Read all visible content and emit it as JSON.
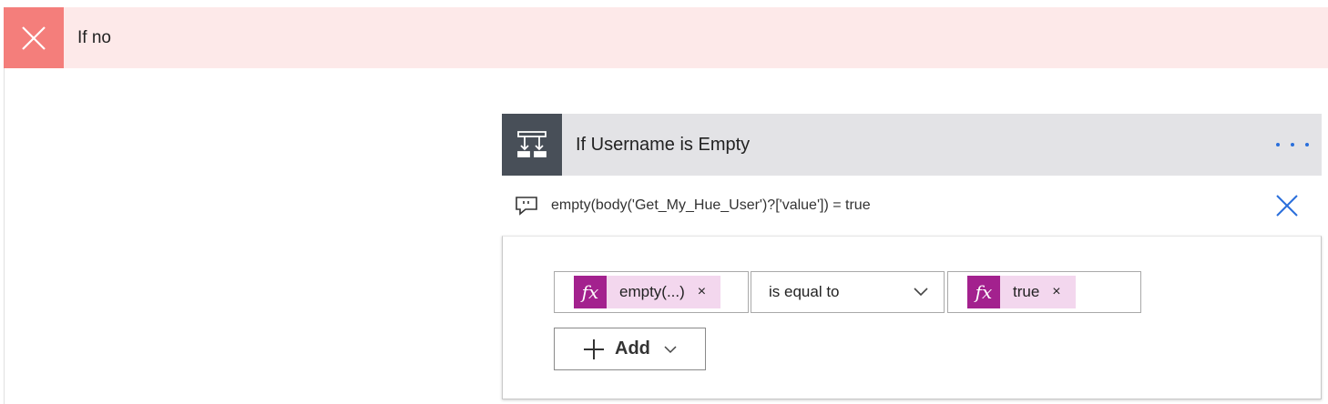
{
  "branch": {
    "title": "If no",
    "icon": "close-icon",
    "accent_color": "#f47e7b",
    "background_color": "#fde9e9"
  },
  "condition_card": {
    "title": "If Username is Empty",
    "icon": "condition-icon",
    "more_icon": "more-options-icon",
    "expression": {
      "icon": "comment-icon",
      "text": "empty(body('Get_My_Hue_User')?['value']) = true",
      "close_icon": "close-icon"
    },
    "row": {
      "left_token": {
        "label": "empty(...)",
        "fx_icon": "fx-icon",
        "remove": "×"
      },
      "operator": {
        "selected": "is equal to",
        "icon": "chevron-down-icon"
      },
      "right_token": {
        "label": "true",
        "fx_icon": "fx-icon",
        "remove": "×"
      }
    },
    "add_button": {
      "label": "Add",
      "icon": "plus-icon"
    }
  },
  "colors": {
    "token_fx": "#a3218e",
    "token_bg": "#f3d7ee",
    "link_blue": "#2a6fdb",
    "header_dark": "#484f58",
    "header_light": "#e3e3e6"
  }
}
